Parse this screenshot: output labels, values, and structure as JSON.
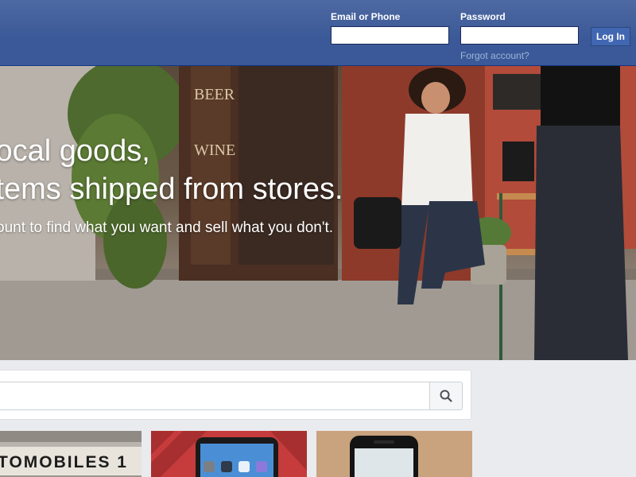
{
  "login": {
    "email_label": "Email or Phone",
    "email_value": "",
    "password_label": "Password",
    "password_value": "",
    "login_button": "Log In",
    "forgot_link": "Forgot account?"
  },
  "hero": {
    "line1": "local goods,",
    "line2": "items shipped from stores.",
    "subline": "ount to find what you want and sell what you don't."
  },
  "search": {
    "value": "",
    "icon": "search-icon"
  },
  "products": [
    {
      "sign_text": "TOMOBILES 1"
    },
    {
      "image": "phone-screen-icons"
    },
    {
      "image": "phone-front"
    }
  ],
  "colors": {
    "topbar": "#3b5998",
    "login_button": "#4267b2",
    "page_background": "#e9ebee",
    "link": "#9cb4d8"
  }
}
